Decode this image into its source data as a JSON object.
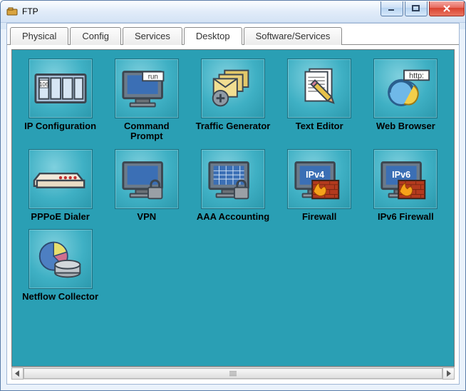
{
  "window": {
    "title": "FTP"
  },
  "tabs": [
    {
      "label": "Physical",
      "active": false
    },
    {
      "label": "Config",
      "active": false
    },
    {
      "label": "Services",
      "active": false
    },
    {
      "label": "Desktop",
      "active": true
    },
    {
      "label": "Software/Services",
      "active": false
    }
  ],
  "apps": [
    {
      "id": "ip-configuration",
      "label": "IP Configuration",
      "icon": "ipconfig"
    },
    {
      "id": "command-prompt",
      "label": "Command Prompt",
      "icon": "cmd"
    },
    {
      "id": "traffic-generator",
      "label": "Traffic Generator",
      "icon": "traffic"
    },
    {
      "id": "text-editor",
      "label": "Text Editor",
      "icon": "texteditor"
    },
    {
      "id": "web-browser",
      "label": "Web Browser",
      "icon": "browser"
    },
    {
      "id": "pppoe-dialer",
      "label": "PPPoE Dialer",
      "icon": "pppoe"
    },
    {
      "id": "vpn",
      "label": "VPN",
      "icon": "vpn"
    },
    {
      "id": "aaa-accounting",
      "label": "AAA Accounting",
      "icon": "aaa"
    },
    {
      "id": "firewall",
      "label": "Firewall",
      "icon": "fw4"
    },
    {
      "id": "ipv6-firewall",
      "label": "IPv6 Firewall",
      "icon": "fw6"
    },
    {
      "id": "netflow-collector",
      "label": "Netflow Collector",
      "icon": "netflow"
    }
  ],
  "icon_text": {
    "ipconfig": "106",
    "cmd": "run",
    "browser": "http:",
    "fw4": "IPv4",
    "fw6": "IPv6"
  },
  "colors": {
    "desktop_bg": "#2a9fb4",
    "brick": "#b33a1e"
  }
}
